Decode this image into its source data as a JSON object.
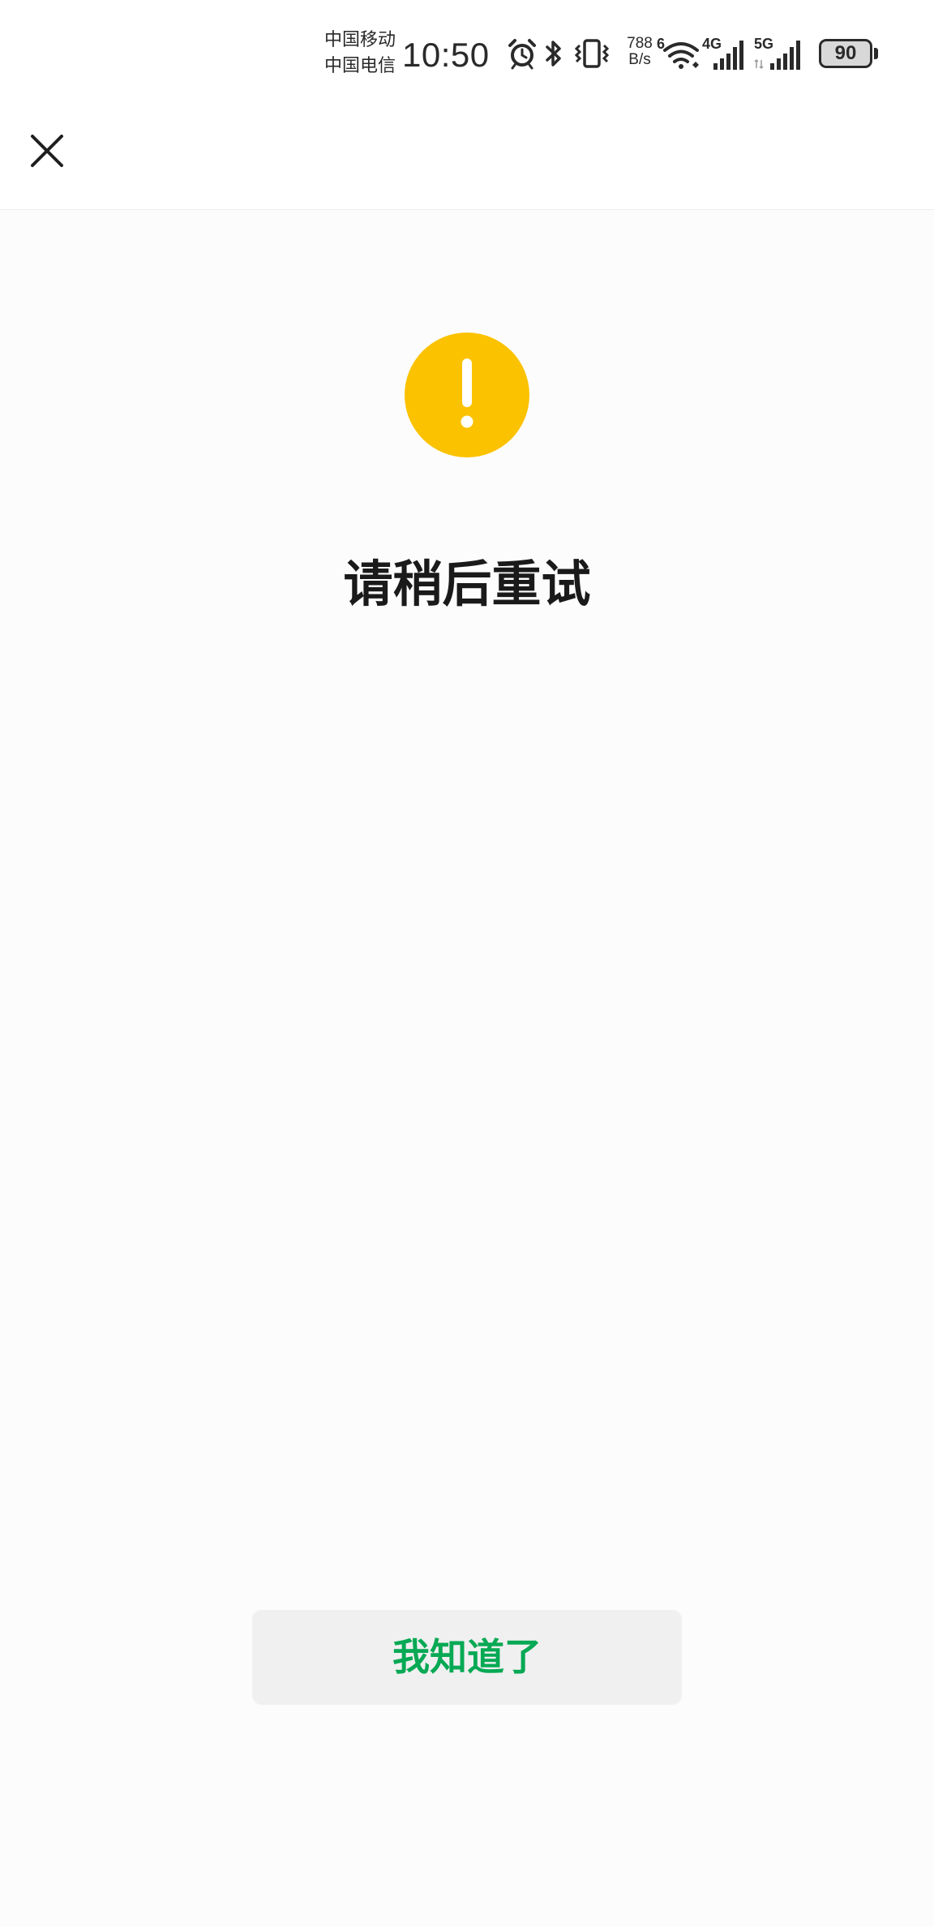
{
  "status_bar": {
    "carrier_1": "中国移动",
    "carrier_2": "中国电信",
    "time": "10:50",
    "net_speed_value": "788",
    "net_speed_unit": "B/s",
    "wifi_badge": "6",
    "sim1_network": "4G",
    "sim2_network": "5G",
    "battery_level": "90",
    "icons": [
      "alarm-icon",
      "bluetooth-icon",
      "vibrate-icon",
      "wifi-icon",
      "signal-icon",
      "signal-icon",
      "battery-icon"
    ]
  },
  "nav": {
    "close_icon": "close-icon"
  },
  "result": {
    "status_icon": "exclamation-icon",
    "status_color": "#fbc200",
    "title": "请稍后重试"
  },
  "actions": {
    "confirm_label": "我知道了",
    "confirm_color": "#07a954"
  }
}
